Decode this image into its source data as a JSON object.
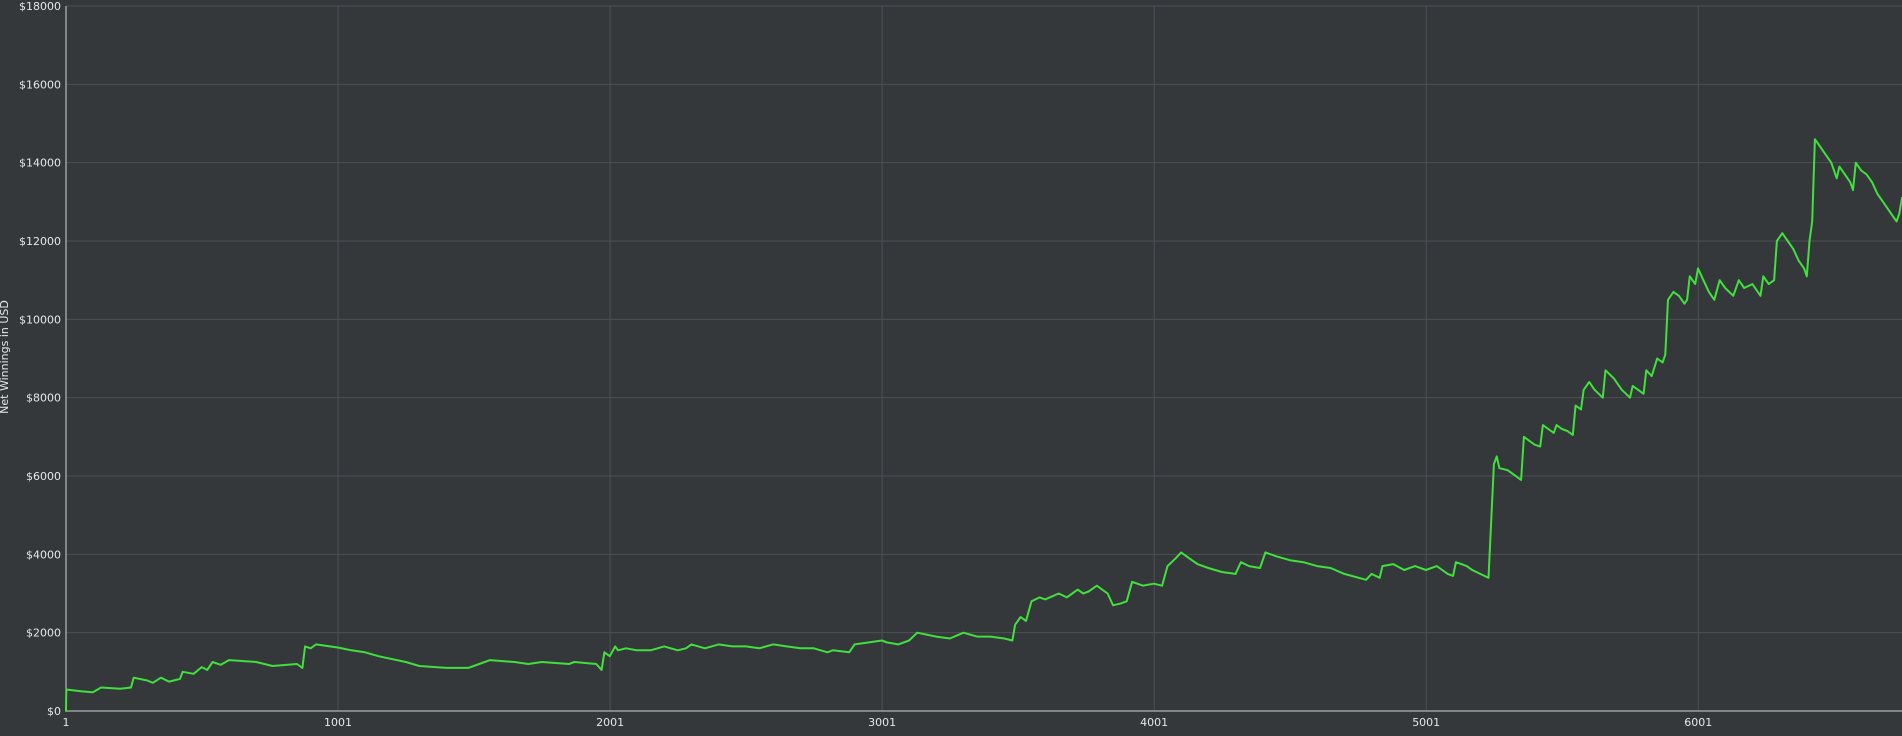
{
  "chart_data": {
    "type": "line",
    "title": "",
    "xlabel": "",
    "ylabel": "Net Winnings in USD",
    "xlim": [
      1,
      6750
    ],
    "ylim": [
      0,
      18000
    ],
    "x_ticks": [
      {
        "value": 1,
        "label": "1"
      },
      {
        "value": 1001,
        "label": "1001"
      },
      {
        "value": 2001,
        "label": "2001"
      },
      {
        "value": 3001,
        "label": "3001"
      },
      {
        "value": 4001,
        "label": "4001"
      },
      {
        "value": 5001,
        "label": "5001"
      },
      {
        "value": 6001,
        "label": "6001"
      }
    ],
    "y_ticks": [
      {
        "value": 0,
        "label": "$0"
      },
      {
        "value": 2000,
        "label": "$2000"
      },
      {
        "value": 4000,
        "label": "$4000"
      },
      {
        "value": 6000,
        "label": "$6000"
      },
      {
        "value": 8000,
        "label": "$8000"
      },
      {
        "value": 10000,
        "label": "$10000"
      },
      {
        "value": 12000,
        "label": "$12000"
      },
      {
        "value": 14000,
        "label": "$14000"
      },
      {
        "value": 16000,
        "label": "$16000"
      },
      {
        "value": 18000,
        "label": "$18000"
      }
    ],
    "grid": true,
    "colors": {
      "line": "#41e03d",
      "background": "#35383b",
      "grid": "#4c5054",
      "axis": "#d8d8d8",
      "text": "#e6e6e6"
    },
    "series": [
      {
        "points": [
          [
            1,
            0
          ],
          [
            2,
            550
          ],
          [
            60,
            500
          ],
          [
            100,
            480
          ],
          [
            130,
            600
          ],
          [
            200,
            570
          ],
          [
            240,
            600
          ],
          [
            250,
            850
          ],
          [
            300,
            780
          ],
          [
            320,
            720
          ],
          [
            350,
            850
          ],
          [
            380,
            750
          ],
          [
            420,
            820
          ],
          [
            430,
            1000
          ],
          [
            470,
            950
          ],
          [
            500,
            1120
          ],
          [
            520,
            1050
          ],
          [
            540,
            1250
          ],
          [
            570,
            1180
          ],
          [
            600,
            1300
          ],
          [
            700,
            1250
          ],
          [
            760,
            1150
          ],
          [
            850,
            1200
          ],
          [
            870,
            1100
          ],
          [
            880,
            1650
          ],
          [
            900,
            1600
          ],
          [
            920,
            1700
          ],
          [
            1000,
            1620
          ],
          [
            1050,
            1550
          ],
          [
            1100,
            1500
          ],
          [
            1150,
            1400
          ],
          [
            1250,
            1250
          ],
          [
            1300,
            1150
          ],
          [
            1400,
            1100
          ],
          [
            1480,
            1100
          ],
          [
            1520,
            1200
          ],
          [
            1560,
            1300
          ],
          [
            1650,
            1250
          ],
          [
            1700,
            1200
          ],
          [
            1750,
            1250
          ],
          [
            1850,
            1200
          ],
          [
            1870,
            1250
          ],
          [
            1950,
            1200
          ],
          [
            1970,
            1050
          ],
          [
            1980,
            1500
          ],
          [
            2000,
            1400
          ],
          [
            2020,
            1650
          ],
          [
            2030,
            1550
          ],
          [
            2060,
            1600
          ],
          [
            2100,
            1550
          ],
          [
            2150,
            1550
          ],
          [
            2200,
            1650
          ],
          [
            2250,
            1550
          ],
          [
            2280,
            1600
          ],
          [
            2300,
            1700
          ],
          [
            2350,
            1600
          ],
          [
            2400,
            1700
          ],
          [
            2450,
            1650
          ],
          [
            2500,
            1650
          ],
          [
            2550,
            1600
          ],
          [
            2600,
            1700
          ],
          [
            2650,
            1650
          ],
          [
            2700,
            1600
          ],
          [
            2750,
            1600
          ],
          [
            2800,
            1500
          ],
          [
            2820,
            1550
          ],
          [
            2880,
            1500
          ],
          [
            2900,
            1700
          ],
          [
            2950,
            1750
          ],
          [
            3000,
            1800
          ],
          [
            3020,
            1750
          ],
          [
            3060,
            1700
          ],
          [
            3100,
            1800
          ],
          [
            3130,
            2000
          ],
          [
            3200,
            1900
          ],
          [
            3250,
            1850
          ],
          [
            3300,
            2000
          ],
          [
            3350,
            1900
          ],
          [
            3400,
            1900
          ],
          [
            3450,
            1850
          ],
          [
            3480,
            1800
          ],
          [
            3490,
            2200
          ],
          [
            3510,
            2400
          ],
          [
            3530,
            2300
          ],
          [
            3550,
            2800
          ],
          [
            3580,
            2900
          ],
          [
            3600,
            2850
          ],
          [
            3650,
            3000
          ],
          [
            3680,
            2900
          ],
          [
            3700,
            3000
          ],
          [
            3720,
            3100
          ],
          [
            3740,
            3000
          ],
          [
            3760,
            3050
          ],
          [
            3790,
            3200
          ],
          [
            3830,
            3000
          ],
          [
            3850,
            2700
          ],
          [
            3880,
            2750
          ],
          [
            3900,
            2800
          ],
          [
            3920,
            3300
          ],
          [
            3960,
            3200
          ],
          [
            4000,
            3250
          ],
          [
            4030,
            3200
          ],
          [
            4050,
            3700
          ],
          [
            4080,
            3900
          ],
          [
            4100,
            4050
          ],
          [
            4130,
            3900
          ],
          [
            4160,
            3750
          ],
          [
            4200,
            3650
          ],
          [
            4250,
            3550
          ],
          [
            4300,
            3500
          ],
          [
            4320,
            3800
          ],
          [
            4350,
            3700
          ],
          [
            4390,
            3650
          ],
          [
            4410,
            4050
          ],
          [
            4450,
            3950
          ],
          [
            4500,
            3850
          ],
          [
            4550,
            3800
          ],
          [
            4600,
            3700
          ],
          [
            4650,
            3650
          ],
          [
            4700,
            3500
          ],
          [
            4780,
            3350
          ],
          [
            4800,
            3500
          ],
          [
            4830,
            3400
          ],
          [
            4840,
            3700
          ],
          [
            4880,
            3750
          ],
          [
            4920,
            3600
          ],
          [
            4960,
            3700
          ],
          [
            5000,
            3600
          ],
          [
            5040,
            3700
          ],
          [
            5080,
            3500
          ],
          [
            5100,
            3450
          ],
          [
            5110,
            3800
          ],
          [
            5130,
            3750
          ],
          [
            5150,
            3700
          ],
          [
            5170,
            3600
          ],
          [
            5200,
            3500
          ],
          [
            5230,
            3400
          ],
          [
            5250,
            6300
          ],
          [
            5260,
            6500
          ],
          [
            5270,
            6200
          ],
          [
            5300,
            6150
          ],
          [
            5320,
            6050
          ],
          [
            5340,
            5950
          ],
          [
            5350,
            5900
          ],
          [
            5360,
            7000
          ],
          [
            5380,
            6900
          ],
          [
            5400,
            6800
          ],
          [
            5420,
            6750
          ],
          [
            5430,
            7300
          ],
          [
            5450,
            7200
          ],
          [
            5470,
            7100
          ],
          [
            5480,
            7300
          ],
          [
            5500,
            7200
          ],
          [
            5520,
            7150
          ],
          [
            5540,
            7050
          ],
          [
            5550,
            7800
          ],
          [
            5570,
            7700
          ],
          [
            5580,
            8200
          ],
          [
            5600,
            8400
          ],
          [
            5620,
            8200
          ],
          [
            5650,
            8000
          ],
          [
            5660,
            8700
          ],
          [
            5690,
            8500
          ],
          [
            5720,
            8200
          ],
          [
            5750,
            8000
          ],
          [
            5760,
            8300
          ],
          [
            5780,
            8200
          ],
          [
            5800,
            8100
          ],
          [
            5810,
            8700
          ],
          [
            5830,
            8550
          ],
          [
            5850,
            9000
          ],
          [
            5870,
            8900
          ],
          [
            5880,
            9100
          ],
          [
            5890,
            10500
          ],
          [
            5910,
            10700
          ],
          [
            5930,
            10600
          ],
          [
            5950,
            10400
          ],
          [
            5960,
            10500
          ],
          [
            5970,
            11100
          ],
          [
            5990,
            10900
          ],
          [
            6000,
            11300
          ],
          [
            6020,
            11000
          ],
          [
            6040,
            10700
          ],
          [
            6060,
            10500
          ],
          [
            6080,
            11000
          ],
          [
            6100,
            10800
          ],
          [
            6130,
            10600
          ],
          [
            6150,
            11000
          ],
          [
            6170,
            10800
          ],
          [
            6200,
            10900
          ],
          [
            6230,
            10600
          ],
          [
            6240,
            11100
          ],
          [
            6260,
            10900
          ],
          [
            6280,
            11000
          ],
          [
            6290,
            12000
          ],
          [
            6310,
            12200
          ],
          [
            6330,
            12000
          ],
          [
            6350,
            11800
          ],
          [
            6370,
            11500
          ],
          [
            6390,
            11300
          ],
          [
            6400,
            11100
          ],
          [
            6410,
            12000
          ],
          [
            6420,
            12500
          ],
          [
            6430,
            14600
          ],
          [
            6450,
            14400
          ],
          [
            6470,
            14200
          ],
          [
            6490,
            14000
          ],
          [
            6510,
            13600
          ],
          [
            6520,
            13900
          ],
          [
            6540,
            13700
          ],
          [
            6560,
            13500
          ],
          [
            6570,
            13300
          ],
          [
            6580,
            14000
          ],
          [
            6600,
            13800
          ],
          [
            6620,
            13700
          ],
          [
            6640,
            13500
          ],
          [
            6660,
            13200
          ],
          [
            6680,
            13000
          ],
          [
            6700,
            12800
          ],
          [
            6720,
            12600
          ],
          [
            6730,
            12500
          ],
          [
            6740,
            12700
          ],
          [
            6750,
            13100
          ]
        ]
      }
    ]
  }
}
